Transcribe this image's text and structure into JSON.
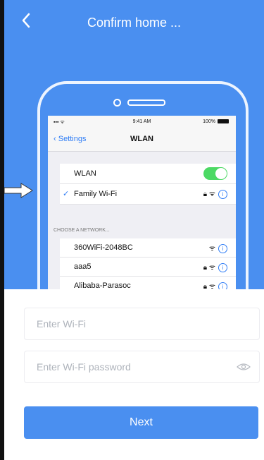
{
  "header": {
    "title": "Confirm home ..."
  },
  "illustration": {
    "status_bar": {
      "time": "9:41 AM",
      "battery": "100%"
    },
    "nav": {
      "back_label": "Settings",
      "title": "WLAN"
    },
    "wlan_toggle": {
      "label": "WLAN",
      "state": "on"
    },
    "connected_network": {
      "name": "Family Wi-Fi"
    },
    "section_header": "CHOOSE A NETWORK...",
    "networks": [
      {
        "name": "360WiFi-2048BC"
      },
      {
        "name": "aaa5"
      },
      {
        "name": "Alibaba-Parasoc"
      }
    ]
  },
  "form": {
    "wifi_placeholder": "Enter Wi-Fi",
    "password_placeholder": "Enter Wi-Fi password",
    "next_label": "Next"
  },
  "colors": {
    "accent": "#4a8ff0",
    "toggle_on": "#4cd964",
    "ios_link": "#2f7df6"
  }
}
